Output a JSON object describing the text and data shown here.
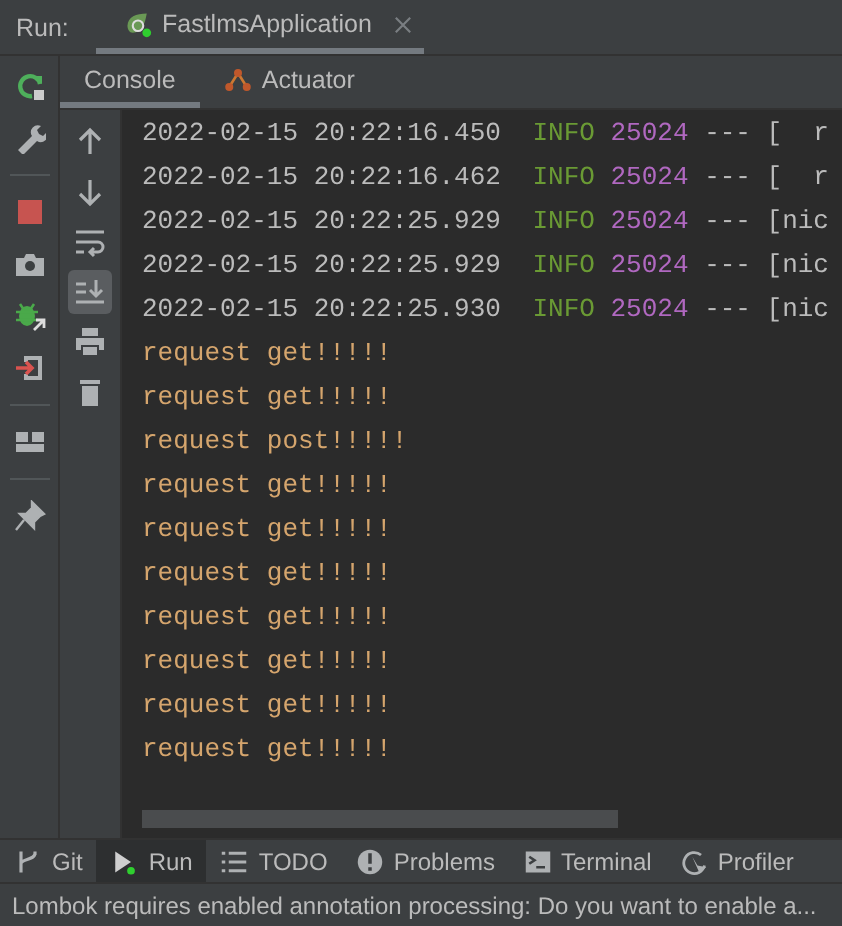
{
  "run_bar": {
    "label": "Run:",
    "tabs": [
      {
        "label": "FastlmsApplication",
        "selected": true
      }
    ]
  },
  "console_tabs": [
    {
      "label": "Console",
      "selected": true,
      "kind": "console"
    },
    {
      "label": "Actuator",
      "selected": false,
      "kind": "actuator"
    }
  ],
  "scroll_to_end": {
    "on": true
  },
  "log_lines": [
    {
      "kind": "log",
      "timestamp": "2022-02-15 20:22:16.450",
      "level": "INFO",
      "pid": "25024",
      "separator": "---",
      "tail": "[  r"
    },
    {
      "kind": "log",
      "timestamp": "2022-02-15 20:22:16.462",
      "level": "INFO",
      "pid": "25024",
      "separator": "---",
      "tail": "[  r"
    },
    {
      "kind": "log",
      "timestamp": "2022-02-15 20:22:25.929",
      "level": "INFO",
      "pid": "25024",
      "separator": "---",
      "tail": "[nic"
    },
    {
      "kind": "log",
      "timestamp": "2022-02-15 20:22:25.929",
      "level": "INFO",
      "pid": "25024",
      "separator": "---",
      "tail": "[nic"
    },
    {
      "kind": "log",
      "timestamp": "2022-02-15 20:22:25.930",
      "level": "INFO",
      "pid": "25024",
      "separator": "---",
      "tail": "[nic"
    },
    {
      "kind": "output",
      "text": "request get!!!!!"
    },
    {
      "kind": "output",
      "text": "request get!!!!!"
    },
    {
      "kind": "output",
      "text": "request post!!!!!"
    },
    {
      "kind": "output",
      "text": "request get!!!!!"
    },
    {
      "kind": "output",
      "text": "request get!!!!!"
    },
    {
      "kind": "output",
      "text": "request get!!!!!"
    },
    {
      "kind": "output",
      "text": "request get!!!!!"
    },
    {
      "kind": "output",
      "text": "request get!!!!!"
    },
    {
      "kind": "output",
      "text": "request get!!!!!"
    },
    {
      "kind": "output",
      "text": "request get!!!!!"
    }
  ],
  "tool_windows": [
    {
      "label": "Git",
      "kind": "git",
      "selected": false
    },
    {
      "label": "Run",
      "kind": "run",
      "selected": true
    },
    {
      "label": "TODO",
      "kind": "todo",
      "selected": false
    },
    {
      "label": "Problems",
      "kind": "problems",
      "selected": false
    },
    {
      "label": "Terminal",
      "kind": "terminal",
      "selected": false
    },
    {
      "label": "Profiler",
      "kind": "profiler",
      "selected": false
    }
  ],
  "status_bar": {
    "message": "Lombok requires enabled annotation processing: Do you want to enable a..."
  }
}
